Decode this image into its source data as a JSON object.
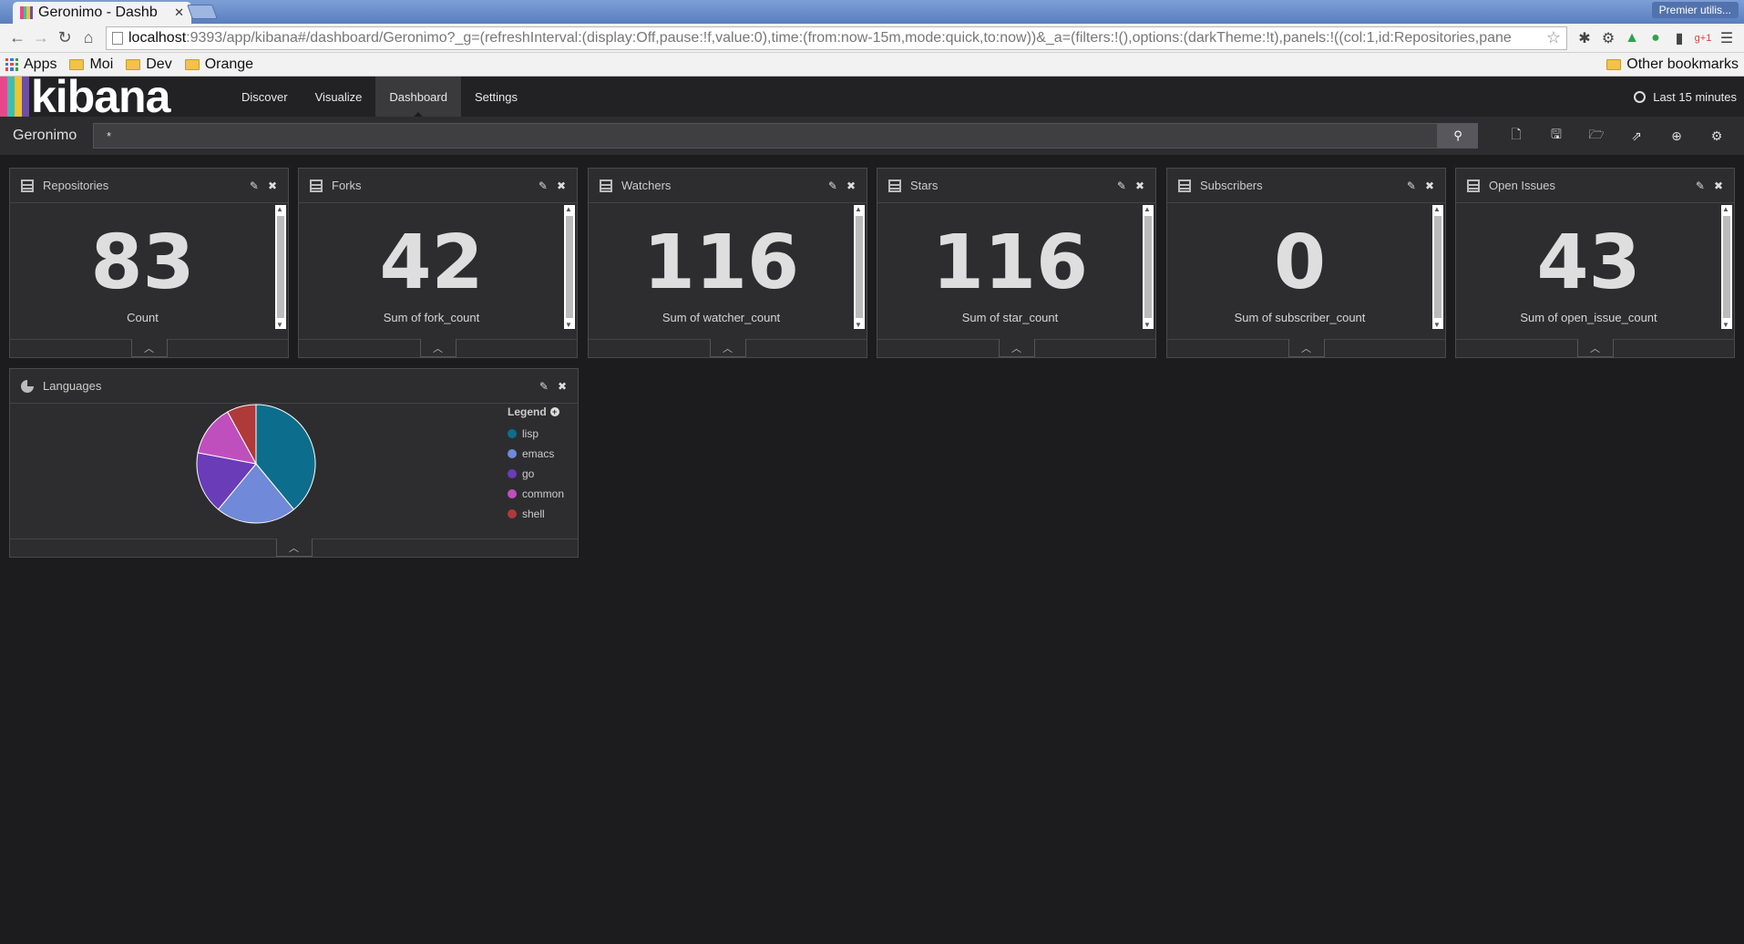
{
  "browser": {
    "tab_title": "Geronimo - Dashb",
    "profile_label": "Premier utilis...",
    "url_host": "localhost",
    "url_rest": ":9393/app/kibana#/dashboard/Geronimo?_g=(refreshInterval:(display:Off,pause:!f,value:0),time:(from:now-15m,mode:quick,to:now))&_a=(filters:!(),options:(darkTheme:!t),panels:!((col:1,id:Repositories,pane",
    "bookmarks": [
      "Apps",
      "Moi",
      "Dev",
      "Orange"
    ],
    "other_bookmarks": "Other bookmarks"
  },
  "kibana": {
    "logo_text": "kibana",
    "logo_colors": [
      "#e8488b",
      "#3cbeb0",
      "#f4c22b",
      "#6c4f9e"
    ],
    "nav": [
      "Discover",
      "Visualize",
      "Dashboard",
      "Settings"
    ],
    "active_nav": "Dashboard",
    "time_range": "Last 15 minutes",
    "dashboard_title": "Geronimo",
    "query": "*"
  },
  "metrics": [
    {
      "title": "Repositories",
      "value": "83",
      "label": "Count"
    },
    {
      "title": "Forks",
      "value": "42",
      "label": "Sum of fork_count"
    },
    {
      "title": "Watchers",
      "value": "116",
      "label": "Sum of watcher_count"
    },
    {
      "title": "Stars",
      "value": "116",
      "label": "Sum of star_count"
    },
    {
      "title": "Subscribers",
      "value": "0",
      "label": "Sum of subscriber_count"
    },
    {
      "title": "Open Issues",
      "value": "43",
      "label": "Sum of open_issue_count"
    }
  ],
  "languages_panel": {
    "title": "Languages",
    "legend_title": "Legend"
  },
  "chart_data": {
    "type": "pie",
    "categories": [
      "lisp",
      "emacs",
      "go",
      "common",
      "shell"
    ],
    "values": [
      39,
      22,
      17,
      14,
      8
    ],
    "colors": [
      "#0c6e8c",
      "#7089d8",
      "#6a3cb8",
      "#c04fbe",
      "#b03a3a"
    ],
    "legend": "right"
  }
}
